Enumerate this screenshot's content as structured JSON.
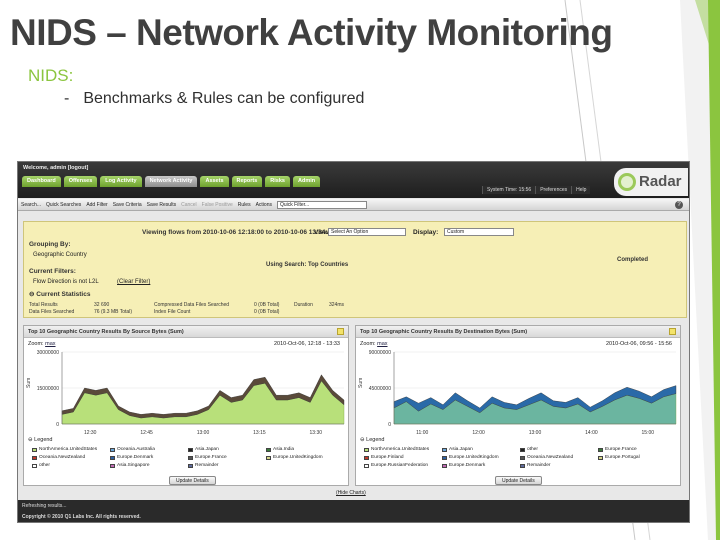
{
  "slide": {
    "title": "NIDS – Network Activity Monitoring",
    "bullet": "NIDS:",
    "sub_bullet": "Benchmarks & Rules can be configured",
    "dash": "-"
  },
  "app": {
    "welcome": "Welcome, admin [logout]",
    "nav_tabs": [
      {
        "label": "Dashboard",
        "active": false
      },
      {
        "label": "Offenses",
        "active": false
      },
      {
        "label": "Log Activity",
        "active": false
      },
      {
        "label": "Network Activity",
        "active": true
      },
      {
        "label": "Assets",
        "active": false
      },
      {
        "label": "Reports",
        "active": false
      },
      {
        "label": "Risks",
        "active": false
      },
      {
        "label": "Admin",
        "active": false
      }
    ],
    "system_time": "System Time: 15:56",
    "preferences": "Preferences",
    "help": "Help",
    "logo_text": "Radar",
    "toolbar": {
      "search": "Search...",
      "quick_searches": "Quick Searches",
      "add_filter": "Add Filter",
      "save_criteria": "Save Criteria",
      "save_results": "Save Results",
      "cancel": "Cancel",
      "false_positive": "False Positive",
      "rules": "Rules",
      "actions": "Actions",
      "quick_filter_placeholder": "Quick Filter..."
    },
    "panel": {
      "viewing": "Viewing flows from 2010-10-06 12:18:00 to 2010-10-06 13:34:00",
      "view_label": "View:",
      "view_value": "Select An Option",
      "display_label": "Display:",
      "display_value": "Custom",
      "grouping_label": "Grouping By:",
      "grouping_value": "Geographic Country",
      "using_search": "Using Search: Top Countries",
      "status": "Completed",
      "current_filters_label": "Current Filters:",
      "filter_value": "Flow Direction is not L2L",
      "clear_filter": "(Clear Filter)",
      "current_statistics_label": "Current Statistics",
      "stats": {
        "total_results_label": "Total Results",
        "total_results_value": "32 690",
        "data_files_label": "Data Files Searched",
        "data_files_value": "76 (9.3 MB Total)",
        "compressed_label": "Compressed Data Files Searched",
        "compressed_value": "0 (0B Total)",
        "index_label": "Index File Count",
        "index_value": "0 (0B Total)",
        "duration_label": "Duration",
        "duration_value": "324ms"
      }
    },
    "hide_charts": "(Hide Charts)",
    "status_text": "Refreshing results...",
    "copyright": "Copyright © 2010 Q1 Labs Inc. All rights reserved."
  },
  "charts": [
    {
      "title": "Top 10 Geographic Country Results By Source Bytes (Sum)",
      "zoom_label": "Zoom:",
      "zoom_value": "max",
      "time_range": "2010-Oct-06, 12:18 - 13:33",
      "update_label": "Update Details",
      "legend_title": "Legend",
      "legend": [
        {
          "label": "NorthAmerica.UnitedStates",
          "color": "#b8e07a"
        },
        {
          "label": "Oceania.Australia",
          "color": "#6aa6d8"
        },
        {
          "label": "Asia.Japan",
          "color": "#222222"
        },
        {
          "label": "Asia.India",
          "color": "#3a7a3a"
        },
        {
          "label": "Oceania.NewZealand",
          "color": "#c0392b"
        },
        {
          "label": "Europe.Denmark",
          "color": "#2e5f9e"
        },
        {
          "label": "Europe.France",
          "color": "#555555"
        },
        {
          "label": "Europe.UnitedKingdom",
          "color": "#d6d68a"
        },
        {
          "label": "other",
          "color": "#ffffff"
        },
        {
          "label": "Asia.Singapore",
          "color": "#c26bb5"
        },
        {
          "label": "Remainder",
          "color": "#5e6a9c"
        }
      ]
    },
    {
      "title": "Top 10 Geographic Country Results By Destination Bytes (Sum)",
      "zoom_label": "Zoom:",
      "zoom_value": "max",
      "time_range": "2010-Oct-06, 09:56 - 15:56",
      "update_label": "Update Details",
      "legend_title": "Legend",
      "legend": [
        {
          "label": "NorthAmerica.UnitedStates",
          "color": "#b8e07a"
        },
        {
          "label": "Asia.Japan",
          "color": "#6aa6d8"
        },
        {
          "label": "other",
          "color": "#222222"
        },
        {
          "label": "Europe.France",
          "color": "#3a7a3a"
        },
        {
          "label": "Europe.Finland",
          "color": "#c0392b"
        },
        {
          "label": "Europe.UnitedKingdom",
          "color": "#2e5f9e"
        },
        {
          "label": "Oceania.NewZealand",
          "color": "#555555"
        },
        {
          "label": "Europe.Portugal",
          "color": "#d6d68a"
        },
        {
          "label": "Europe.RussianFederation",
          "color": "#ffffff"
        },
        {
          "label": "Europe.Denmark",
          "color": "#c26bb5"
        },
        {
          "label": "Remainder",
          "color": "#5e6a9c"
        }
      ]
    }
  ],
  "chart_data": [
    {
      "type": "area",
      "ylabel": "Sum",
      "yticks": [
        "30000000",
        "15000000",
        "0"
      ],
      "xticks": [
        "12:30",
        "12:45",
        "13:00",
        "13:15",
        "13:30"
      ],
      "ylim": [
        0,
        30000000
      ],
      "x": [
        "12:18",
        "12:21",
        "12:24",
        "12:27",
        "12:30",
        "12:33",
        "12:36",
        "12:39",
        "12:42",
        "12:45",
        "12:48",
        "12:51",
        "12:54",
        "12:57",
        "13:00",
        "13:03",
        "13:06",
        "13:09",
        "13:12",
        "13:15",
        "13:18",
        "13:21",
        "13:24",
        "13:27",
        "13:30",
        "13:33"
      ],
      "series": [
        {
          "name": "NorthAmerica.UnitedStates",
          "values": [
            4000000,
            5000000,
            13000000,
            12000000,
            13000000,
            6000000,
            3500000,
            2500000,
            3000000,
            2500000,
            3000000,
            3000000,
            4000000,
            6000000,
            12000000,
            9000000,
            10000000,
            16000000,
            17000000,
            10000000,
            10000000,
            11000000,
            9000000,
            18000000,
            12000000,
            8000000
          ]
        },
        {
          "name": "Remainder",
          "values": [
            1500000,
            1500000,
            2000000,
            2000000,
            2000000,
            1500000,
            1500000,
            1500000,
            1500000,
            1500000,
            1500000,
            1500000,
            1500000,
            1500000,
            2000000,
            2000000,
            2000000,
            2500000,
            2500000,
            2000000,
            2000000,
            2000000,
            2000000,
            2500000,
            2000000,
            2000000
          ]
        }
      ]
    },
    {
      "type": "area",
      "ylabel": "Sum",
      "yticks": [
        "90000000",
        "45000000",
        "0"
      ],
      "xticks": [
        "11:00",
        "12:00",
        "13:00",
        "14:00",
        "15:00"
      ],
      "ylim": [
        0,
        90000000
      ],
      "x": [
        "10:00",
        "10:15",
        "10:30",
        "10:45",
        "11:00",
        "11:15",
        "11:30",
        "11:45",
        "12:00",
        "12:15",
        "12:30",
        "12:45",
        "13:00",
        "13:15",
        "13:30",
        "13:45",
        "14:00",
        "14:15",
        "14:30",
        "14:45",
        "15:00",
        "15:15",
        "15:30",
        "15:45"
      ],
      "series": [
        {
          "name": "NorthAmerica.UnitedStates",
          "values": [
            20000000,
            28000000,
            16000000,
            25000000,
            18000000,
            30000000,
            22000000,
            14000000,
            26000000,
            20000000,
            18000000,
            24000000,
            30000000,
            22000000,
            20000000,
            25000000,
            15000000,
            22000000,
            30000000,
            36000000,
            32000000,
            26000000,
            34000000,
            38000000
          ]
        },
        {
          "name": "other",
          "values": [
            8000000,
            6000000,
            10000000,
            8000000,
            6000000,
            9000000,
            7000000,
            6000000,
            8000000,
            7000000,
            6000000,
            8000000,
            9000000,
            7000000,
            7000000,
            8000000,
            6000000,
            7000000,
            9000000,
            10000000,
            9000000,
            8000000,
            9000000,
            10000000
          ]
        }
      ]
    }
  ]
}
